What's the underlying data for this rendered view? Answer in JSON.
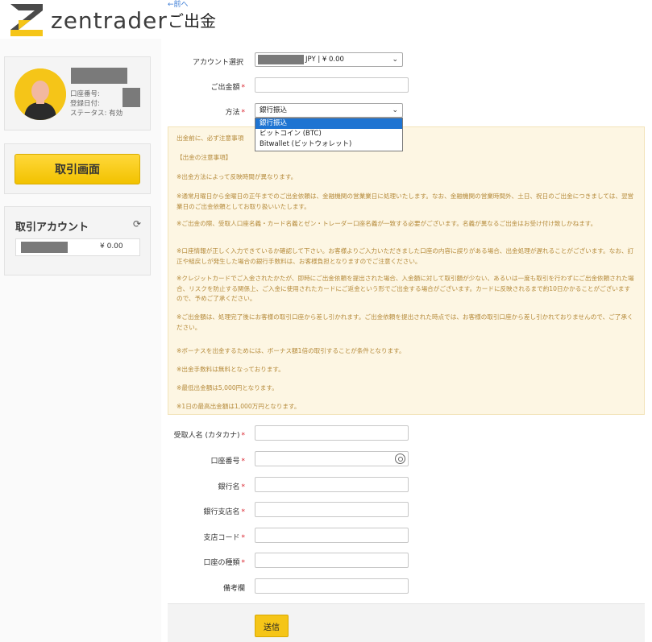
{
  "brand": {
    "name": "zentrader"
  },
  "profile": {
    "account_number_label": "口座番号:",
    "registered_label": "登録日付:",
    "status_label": "ステータス: 有効"
  },
  "sidebar": {
    "trade_button": "取引画面",
    "accounts_title": "取引アカウント",
    "account_balance": "¥ 0.00"
  },
  "page": {
    "back_link": "←前へ",
    "title": "ご出金"
  },
  "form": {
    "account_select_label": "アカウント選択",
    "account_select_value": "JPY | ¥ 0.00",
    "amount_label": "ご出金額",
    "method_label": "方法",
    "method_value": "銀行振込",
    "method_options": [
      "銀行振込",
      "ビットコイン (BTC)",
      "Bitwallet (ビットウォレット)"
    ],
    "recipient_name_label": "受取人名 (カタカナ)",
    "account_no_label": "口座番号",
    "bank_name_label": "銀行名",
    "branch_name_label": "銀行支店名",
    "branch_code_label": "支店コード",
    "account_type_label": "口座の種類",
    "remarks_label": "備考欄",
    "submit": "送信"
  },
  "notice": {
    "intro": "出金前に、必ず注意事項",
    "heading": "【出金の注意事項】",
    "p1": "※出金方法によって反映時間が異なります。",
    "p2": "※通常月曜日から金曜日の正午までのご出金依頼は、金融機関の営業業日に処理いたします。なお、金融機関の営業時間外、土日、祝日のご出金につきましては、翌営業日のご出金依頼としてお取り扱いいたします。",
    "p3": "※ご出金の際、受取人口座名義・カード名義とゼン・トレーダー口座名義が一致する必要がございます。名義が異なるご出金はお受け付け致しかねます。",
    "p4": "※口座情報が正しく入力できているか確認して下さい。お客様よりご入力いただきました口座の内容に誤りがある場合、出金処理が遅れることがございます。なお、訂正や組戻しが発生した場合の銀行手数料は、お客様負担となりますのでご注意ください。",
    "p5": "※クレジットカードでご入金されたかたが、即時にご出金依頼を提出された場合、入金額に対して取引額が少ない、あるいは一度も取引を行わずにご出金依頼された場合、リスクを防止する関係上、ご入金に使用されたカードにご返金という形でご出金する場合がございます。カードに反映されるまで約10日かかることがございますので、予めご了承ください。",
    "p6": "※ご出金額は、処理完了後にお客様の取引口座から差し引かれます。ご出金依頼を提出された時点では、お客様の取引口座から差し引かれておりませんので、ご了承ください。",
    "p7": "※ボーナスを出金するためには、ボーナス額1倍の取引することが条件となります。",
    "p8": "※出金手数料は無料となっております。",
    "p9": "※最低出金額は5,000円となります。",
    "p10": "※1日の最高出金額は1,000万円となります。"
  }
}
